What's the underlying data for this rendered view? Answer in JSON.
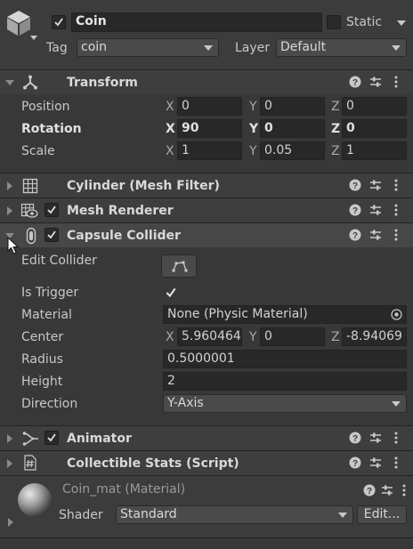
{
  "object": {
    "name": "Coin",
    "static_label": "Static",
    "tag_label": "Tag",
    "tag_value": "coin",
    "layer_label": "Layer",
    "layer_value": "Default"
  },
  "transform": {
    "title": "Transform",
    "rows": [
      {
        "label": "Position",
        "x": "0",
        "y": "0",
        "z": "0"
      },
      {
        "label": "Rotation",
        "x": "90",
        "y": "0",
        "z": "0"
      },
      {
        "label": "Scale",
        "x": "1",
        "y": "0.05",
        "z": "1"
      }
    ],
    "axis_x": "X",
    "axis_y": "Y",
    "axis_z": "Z"
  },
  "components": {
    "mesh_filter": "Cylinder (Mesh Filter)",
    "mesh_renderer": "Mesh Renderer",
    "capsule_collider": "Capsule Collider",
    "animator": "Animator",
    "script": "Collectible Stats (Script)"
  },
  "collider": {
    "edit_collider_label": "Edit Collider",
    "is_trigger_label": "Is Trigger",
    "material_label": "Material",
    "material_value": "None (Physic Material)",
    "center_label": "Center",
    "center_x": "5.960464",
    "center_y": "0",
    "center_z": "-8.94069",
    "radius_label": "Radius",
    "radius_value": "0.5000001",
    "height_label": "Height",
    "height_value": "2",
    "direction_label": "Direction",
    "direction_value": "Y-Axis"
  },
  "material": {
    "name": "Coin_mat (Material)",
    "shader_label": "Shader",
    "shader_value": "Standard",
    "edit_button": "Edit..."
  },
  "icons": [
    "cube-icon",
    "transform-icon",
    "grid-icon",
    "mesh-renderer-icon",
    "capsule-icon",
    "animator-icon",
    "script-icon",
    "help-icon",
    "preset-icon",
    "more-icon",
    "cursor-icon",
    "material-sphere-icon",
    "edit-collider-icon",
    "object-picker-icon"
  ]
}
